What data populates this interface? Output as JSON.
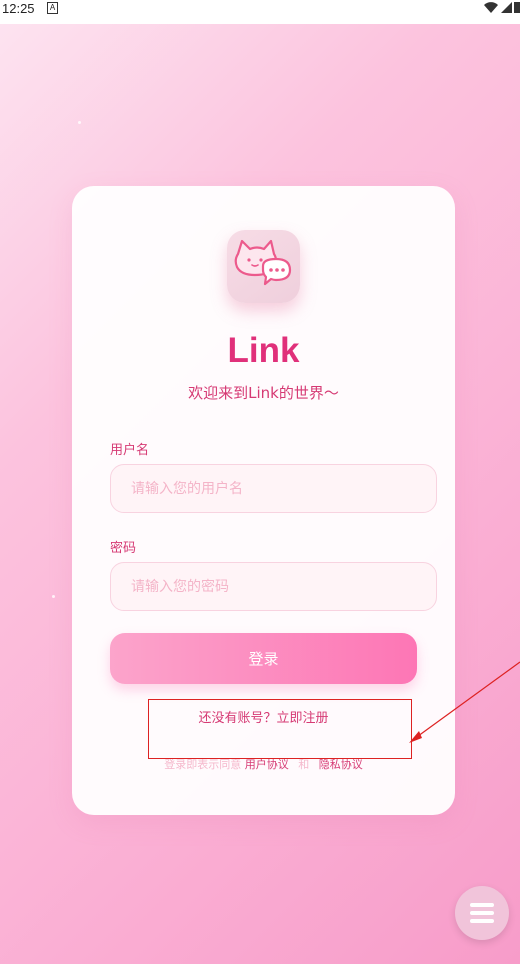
{
  "status_bar": {
    "time": "12:25",
    "notification_icon": "A"
  },
  "app": {
    "title": "Link",
    "subtitle": "欢迎来到Link的世界～"
  },
  "form": {
    "username_label": "用户名",
    "username_placeholder": "请输入您的用户名",
    "password_label": "密码",
    "password_placeholder": "请输入您的密码",
    "login_button": "登录"
  },
  "footer": {
    "register_text": "还没有账号？立即注册",
    "agreement_prefix": "登录即表示同意",
    "user_agreement": "用户协议",
    "separator": "和",
    "privacy_policy": "隐私协议"
  },
  "icons": {
    "logo": "cat-chat-logo-icon",
    "fab": "menu-icon"
  },
  "colors": {
    "accent": "#e0307a",
    "button_start": "#fca4cb",
    "button_end": "#fd76b5",
    "annotation": "#dd2222"
  }
}
